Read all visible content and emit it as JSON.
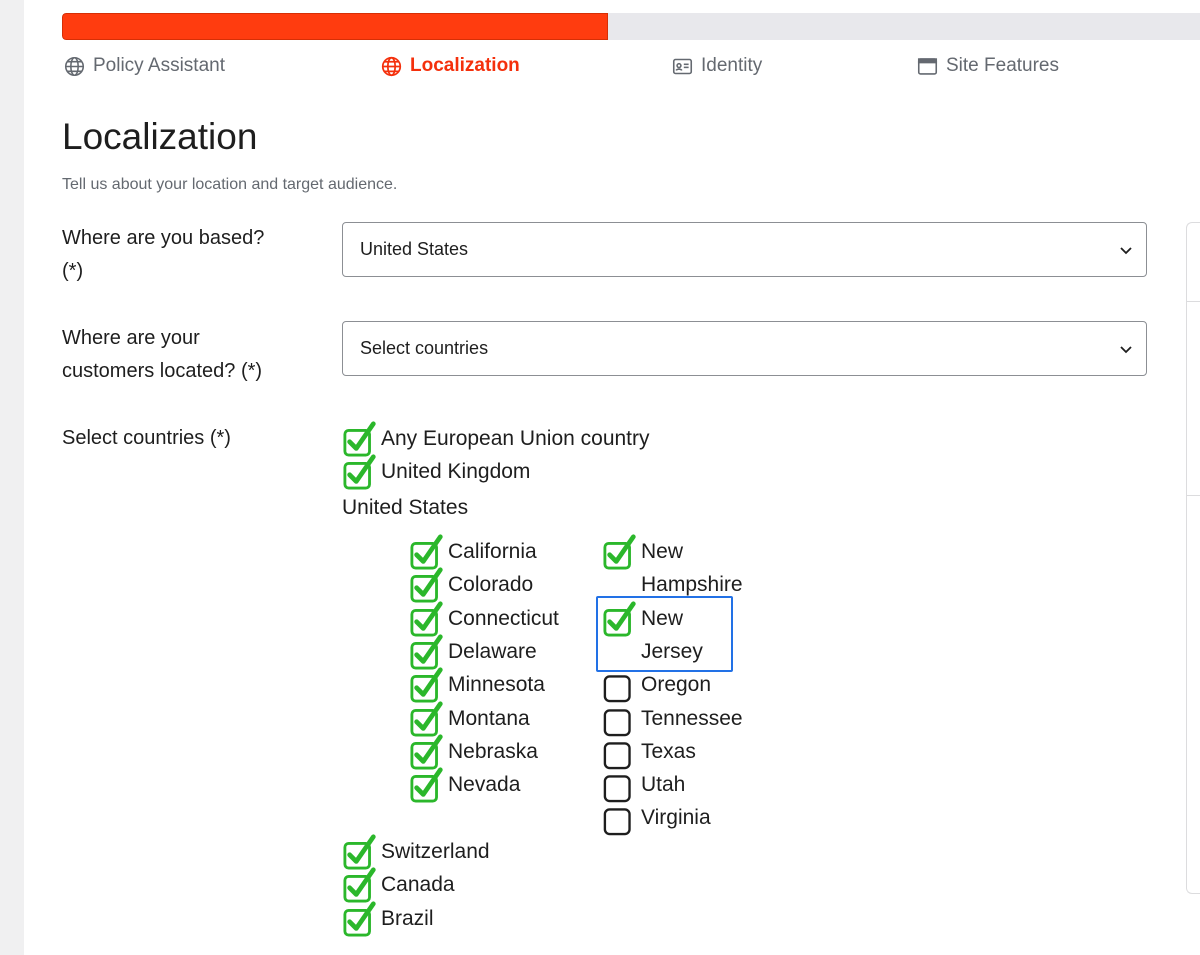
{
  "progress": {
    "fraction": 0.48,
    "fill_color": "#ff3c0f"
  },
  "steps": [
    {
      "label": "Policy Assistant",
      "icon": "globe-icon",
      "active": false
    },
    {
      "label": "Localization",
      "icon": "globe-icon",
      "active": true
    },
    {
      "label": "Identity",
      "icon": "id-card-icon",
      "active": false
    },
    {
      "label": "Site Features",
      "icon": "browser-window-icon",
      "active": false
    }
  ],
  "page": {
    "title": "Localization",
    "subtitle": "Tell us about your location and target audience."
  },
  "based": {
    "label_line1": "Where are you based?",
    "label_line2": "(*)",
    "value": "United States"
  },
  "customers": {
    "label_line1": "Where are your",
    "label_line2": "customers located? (*)",
    "value": "Select countries"
  },
  "countries": {
    "label": "Select countries (*)",
    "top": [
      {
        "label": "Any European Union country",
        "checked": true
      },
      {
        "label": "United Kingdom",
        "checked": true
      }
    ],
    "us_group_label": "United States",
    "states_col1": [
      {
        "label": "California",
        "checked": true
      },
      {
        "label": "Colorado",
        "checked": true
      },
      {
        "label": "Connecticut",
        "checked": true
      },
      {
        "label": "Delaware",
        "checked": true
      },
      {
        "label": "Minnesota",
        "checked": true
      },
      {
        "label": "Montana",
        "checked": true
      },
      {
        "label": "Nebraska",
        "checked": true
      },
      {
        "label": "Nevada",
        "checked": true
      }
    ],
    "states_col2": [
      {
        "label_line1": "New",
        "label_line2": "Hampshire",
        "checked": true
      },
      {
        "label_line1": "New",
        "label_line2": "Jersey",
        "checked": true,
        "focused": true
      },
      {
        "label": "Oregon",
        "checked": false
      },
      {
        "label": "Tennessee",
        "checked": false
      },
      {
        "label": "Texas",
        "checked": false
      },
      {
        "label": "Utah",
        "checked": false
      },
      {
        "label": "Virginia",
        "checked": false
      }
    ],
    "bottom": [
      {
        "label": "Switzerland",
        "checked": true
      },
      {
        "label": "Canada",
        "checked": true
      },
      {
        "label": "Brazil",
        "checked": true
      }
    ]
  },
  "colors": {
    "accent": "#f4300c",
    "check": "#2bb72b",
    "focus": "#2271e6"
  }
}
